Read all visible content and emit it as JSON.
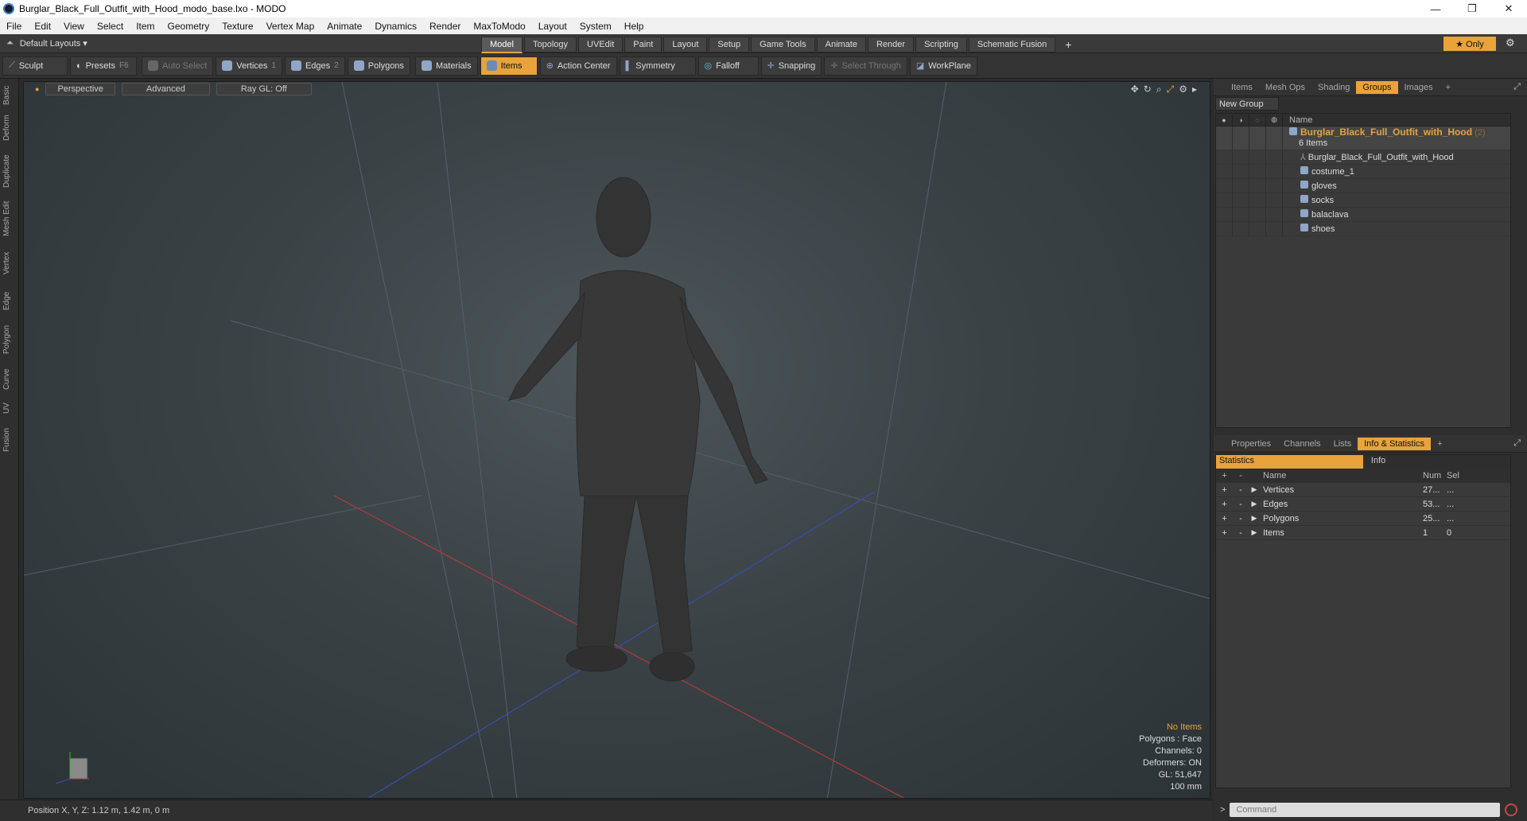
{
  "window": {
    "title": "Burglar_Black_Full_Outfit_with_Hood_modo_base.lxo - MODO",
    "min": "—",
    "max": "❐",
    "close": "✕"
  },
  "menu": [
    "File",
    "Edit",
    "View",
    "Select",
    "Item",
    "Geometry",
    "Texture",
    "Vertex Map",
    "Animate",
    "Dynamics",
    "Render",
    "MaxToModo",
    "Layout",
    "System",
    "Help"
  ],
  "layoutbar": {
    "layouts": "Default Layouts",
    "tabs": [
      "Model",
      "Topology",
      "UVEdit",
      "Paint",
      "Layout",
      "Setup",
      "Game Tools",
      "Animate",
      "Render",
      "Scripting",
      "Schematic Fusion"
    ],
    "add": "+",
    "only": "★  Only"
  },
  "toolbar": {
    "sculpt": "Sculpt",
    "presets": "Presets",
    "presets_key": "F6",
    "auto_select": "Auto Select",
    "vertices": "Vertices",
    "vertices_key": "1",
    "edges": "Edges",
    "edges_key": "2",
    "polygons": "Polygons",
    "materials": "Materials",
    "items": "Items",
    "action_center": "Action Center",
    "symmetry": "Symmetry",
    "falloff": "Falloff",
    "snapping": "Snapping",
    "select_through": "Select Through",
    "workplane": "WorkPlane"
  },
  "left_tabs": [
    "Basic",
    "Deform",
    "Duplicate",
    "Mesh Edit",
    "Vertex",
    "Edge",
    "Polygon",
    "Curve",
    "UV",
    "Fusion"
  ],
  "viewport": {
    "perspective": "Perspective",
    "advanced": "Advanced",
    "raygl": "Ray GL: Off",
    "hud": {
      "no_items": "No Items",
      "polygons": "Polygons : Face",
      "channels": "Channels: 0",
      "deformers": "Deformers: ON",
      "gl": "GL: 51,647",
      "scale": "100 mm"
    }
  },
  "status": "Position X, Y, Z:   1.12 m, 1.42 m, 0 m",
  "top_panel": {
    "tabs": [
      "Items",
      "Mesh Ops",
      "Shading",
      "Groups",
      "Images"
    ],
    "active_tab": "Groups",
    "new_group": "New Group",
    "name_header": "Name",
    "group_name": "Burglar_Black_Full_Outfit_with_Hood",
    "group_count": "(2)",
    "group_items": "6 Items",
    "children": [
      "Burglar_Black_Full_Outfit_with_Hood",
      "costume_1",
      "gloves",
      "socks",
      "balaclava",
      "shoes"
    ]
  },
  "bottom_panel": {
    "tabs": [
      "Properties",
      "Channels",
      "Lists",
      "Info & Statistics"
    ],
    "active_tab": "Info & Statistics",
    "subtabs": [
      "Statistics",
      "Info"
    ],
    "columns": [
      "Name",
      "Num",
      "Sel"
    ],
    "rows": [
      {
        "name": "Vertices",
        "num": "27...",
        "sel": "..."
      },
      {
        "name": "Edges",
        "num": "53...",
        "sel": "..."
      },
      {
        "name": "Polygons",
        "num": "25...",
        "sel": "..."
      },
      {
        "name": "Items",
        "num": "1",
        "sel": "0"
      }
    ]
  },
  "command": {
    "placeholder": "Command",
    "prompt": ">"
  },
  "colors": {
    "accent": "#e8a33a"
  }
}
